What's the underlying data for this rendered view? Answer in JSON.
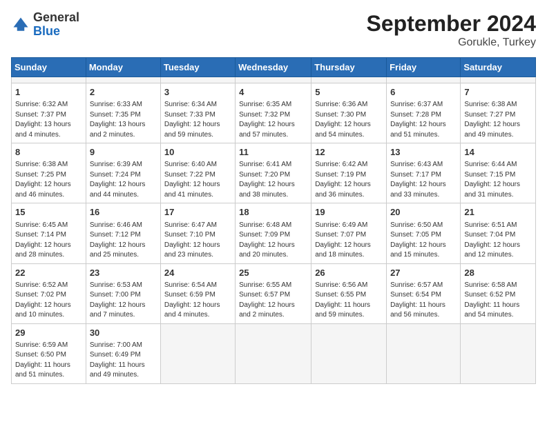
{
  "header": {
    "logo": {
      "general": "General",
      "blue": "Blue"
    },
    "title": "September 2024",
    "subtitle": "Gorukle, Turkey"
  },
  "calendar": {
    "days_of_week": [
      "Sunday",
      "Monday",
      "Tuesday",
      "Wednesday",
      "Thursday",
      "Friday",
      "Saturday"
    ],
    "weeks": [
      [
        {
          "day": "",
          "empty": true
        },
        {
          "day": "",
          "empty": true
        },
        {
          "day": "",
          "empty": true
        },
        {
          "day": "",
          "empty": true
        },
        {
          "day": "",
          "empty": true
        },
        {
          "day": "",
          "empty": true
        },
        {
          "day": "",
          "empty": true
        }
      ],
      [
        {
          "day": "1",
          "sunrise": "Sunrise: 6:32 AM",
          "sunset": "Sunset: 7:37 PM",
          "daylight": "Daylight: 13 hours and 4 minutes."
        },
        {
          "day": "2",
          "sunrise": "Sunrise: 6:33 AM",
          "sunset": "Sunset: 7:35 PM",
          "daylight": "Daylight: 13 hours and 2 minutes."
        },
        {
          "day": "3",
          "sunrise": "Sunrise: 6:34 AM",
          "sunset": "Sunset: 7:33 PM",
          "daylight": "Daylight: 12 hours and 59 minutes."
        },
        {
          "day": "4",
          "sunrise": "Sunrise: 6:35 AM",
          "sunset": "Sunset: 7:32 PM",
          "daylight": "Daylight: 12 hours and 57 minutes."
        },
        {
          "day": "5",
          "sunrise": "Sunrise: 6:36 AM",
          "sunset": "Sunset: 7:30 PM",
          "daylight": "Daylight: 12 hours and 54 minutes."
        },
        {
          "day": "6",
          "sunrise": "Sunrise: 6:37 AM",
          "sunset": "Sunset: 7:28 PM",
          "daylight": "Daylight: 12 hours and 51 minutes."
        },
        {
          "day": "7",
          "sunrise": "Sunrise: 6:38 AM",
          "sunset": "Sunset: 7:27 PM",
          "daylight": "Daylight: 12 hours and 49 minutes."
        }
      ],
      [
        {
          "day": "8",
          "sunrise": "Sunrise: 6:38 AM",
          "sunset": "Sunset: 7:25 PM",
          "daylight": "Daylight: 12 hours and 46 minutes."
        },
        {
          "day": "9",
          "sunrise": "Sunrise: 6:39 AM",
          "sunset": "Sunset: 7:24 PM",
          "daylight": "Daylight: 12 hours and 44 minutes."
        },
        {
          "day": "10",
          "sunrise": "Sunrise: 6:40 AM",
          "sunset": "Sunset: 7:22 PM",
          "daylight": "Daylight: 12 hours and 41 minutes."
        },
        {
          "day": "11",
          "sunrise": "Sunrise: 6:41 AM",
          "sunset": "Sunset: 7:20 PM",
          "daylight": "Daylight: 12 hours and 38 minutes."
        },
        {
          "day": "12",
          "sunrise": "Sunrise: 6:42 AM",
          "sunset": "Sunset: 7:19 PM",
          "daylight": "Daylight: 12 hours and 36 minutes."
        },
        {
          "day": "13",
          "sunrise": "Sunrise: 6:43 AM",
          "sunset": "Sunset: 7:17 PM",
          "daylight": "Daylight: 12 hours and 33 minutes."
        },
        {
          "day": "14",
          "sunrise": "Sunrise: 6:44 AM",
          "sunset": "Sunset: 7:15 PM",
          "daylight": "Daylight: 12 hours and 31 minutes."
        }
      ],
      [
        {
          "day": "15",
          "sunrise": "Sunrise: 6:45 AM",
          "sunset": "Sunset: 7:14 PM",
          "daylight": "Daylight: 12 hours and 28 minutes."
        },
        {
          "day": "16",
          "sunrise": "Sunrise: 6:46 AM",
          "sunset": "Sunset: 7:12 PM",
          "daylight": "Daylight: 12 hours and 25 minutes."
        },
        {
          "day": "17",
          "sunrise": "Sunrise: 6:47 AM",
          "sunset": "Sunset: 7:10 PM",
          "daylight": "Daylight: 12 hours and 23 minutes."
        },
        {
          "day": "18",
          "sunrise": "Sunrise: 6:48 AM",
          "sunset": "Sunset: 7:09 PM",
          "daylight": "Daylight: 12 hours and 20 minutes."
        },
        {
          "day": "19",
          "sunrise": "Sunrise: 6:49 AM",
          "sunset": "Sunset: 7:07 PM",
          "daylight": "Daylight: 12 hours and 18 minutes."
        },
        {
          "day": "20",
          "sunrise": "Sunrise: 6:50 AM",
          "sunset": "Sunset: 7:05 PM",
          "daylight": "Daylight: 12 hours and 15 minutes."
        },
        {
          "day": "21",
          "sunrise": "Sunrise: 6:51 AM",
          "sunset": "Sunset: 7:04 PM",
          "daylight": "Daylight: 12 hours and 12 minutes."
        }
      ],
      [
        {
          "day": "22",
          "sunrise": "Sunrise: 6:52 AM",
          "sunset": "Sunset: 7:02 PM",
          "daylight": "Daylight: 12 hours and 10 minutes."
        },
        {
          "day": "23",
          "sunrise": "Sunrise: 6:53 AM",
          "sunset": "Sunset: 7:00 PM",
          "daylight": "Daylight: 12 hours and 7 minutes."
        },
        {
          "day": "24",
          "sunrise": "Sunrise: 6:54 AM",
          "sunset": "Sunset: 6:59 PM",
          "daylight": "Daylight: 12 hours and 4 minutes."
        },
        {
          "day": "25",
          "sunrise": "Sunrise: 6:55 AM",
          "sunset": "Sunset: 6:57 PM",
          "daylight": "Daylight: 12 hours and 2 minutes."
        },
        {
          "day": "26",
          "sunrise": "Sunrise: 6:56 AM",
          "sunset": "Sunset: 6:55 PM",
          "daylight": "Daylight: 11 hours and 59 minutes."
        },
        {
          "day": "27",
          "sunrise": "Sunrise: 6:57 AM",
          "sunset": "Sunset: 6:54 PM",
          "daylight": "Daylight: 11 hours and 56 minutes."
        },
        {
          "day": "28",
          "sunrise": "Sunrise: 6:58 AM",
          "sunset": "Sunset: 6:52 PM",
          "daylight": "Daylight: 11 hours and 54 minutes."
        }
      ],
      [
        {
          "day": "29",
          "sunrise": "Sunrise: 6:59 AM",
          "sunset": "Sunset: 6:50 PM",
          "daylight": "Daylight: 11 hours and 51 minutes."
        },
        {
          "day": "30",
          "sunrise": "Sunrise: 7:00 AM",
          "sunset": "Sunset: 6:49 PM",
          "daylight": "Daylight: 11 hours and 49 minutes."
        },
        {
          "day": "",
          "empty": true
        },
        {
          "day": "",
          "empty": true
        },
        {
          "day": "",
          "empty": true
        },
        {
          "day": "",
          "empty": true
        },
        {
          "day": "",
          "empty": true
        }
      ]
    ]
  }
}
